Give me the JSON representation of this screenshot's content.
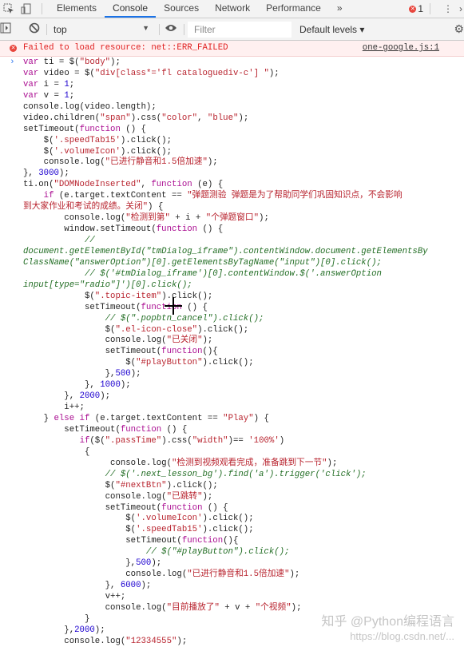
{
  "tabs": {
    "items": [
      "Elements",
      "Console",
      "Sources",
      "Network",
      "Performance"
    ],
    "active": "Console",
    "more": "»",
    "error_count": "1"
  },
  "toolbar": {
    "context": "top",
    "filter_placeholder": "Filter",
    "levels": "Default levels ▾"
  },
  "error": {
    "message": "Failed to load resource: net::ERR_FAILED",
    "source": "one-google.js:1"
  },
  "colors": {
    "keyword": "#aa0d91",
    "string": "#b8232e",
    "number": "#1c00cf",
    "comment": "#236e25",
    "error": "#e02020"
  },
  "watermark": {
    "text": "知乎 @Python编程语言",
    "url": "https://blog.csdn.net/..."
  },
  "code": [
    [
      [
        "k",
        "var"
      ],
      [
        "d",
        " ti = $("
      ],
      [
        "s",
        "\"body\""
      ],
      [
        "d",
        ");"
      ]
    ],
    [
      [
        "k",
        "var"
      ],
      [
        "d",
        " video = $("
      ],
      [
        "s",
        "\"div[class*='fl cataloguediv-c'] \""
      ],
      [
        "d",
        ");"
      ]
    ],
    [
      [
        "k",
        "var"
      ],
      [
        "d",
        " i = "
      ],
      [
        "n",
        "1"
      ],
      [
        "d",
        ";"
      ]
    ],
    [
      [
        "k",
        "var"
      ],
      [
        "d",
        " v = "
      ],
      [
        "n",
        "1"
      ],
      [
        "d",
        ";"
      ]
    ],
    [
      [
        "d",
        "console.log(video.length);"
      ]
    ],
    [
      [
        "d",
        "video.children("
      ],
      [
        "s",
        "\"span\""
      ],
      [
        "d",
        ").css("
      ],
      [
        "s",
        "\"color\""
      ],
      [
        "d",
        ", "
      ],
      [
        "s",
        "\"blue\""
      ],
      [
        "d",
        ");"
      ]
    ],
    [
      [
        "d",
        "setTimeout("
      ],
      [
        "k",
        "function"
      ],
      [
        "d",
        " () {"
      ]
    ],
    [
      [
        "d",
        "    $("
      ],
      [
        "s",
        "'.speedTab15'"
      ],
      [
        "d",
        ").click();"
      ]
    ],
    [
      [
        "d",
        "    $("
      ],
      [
        "s",
        "'.volumeIcon'"
      ],
      [
        "d",
        ").click();"
      ]
    ],
    [
      [
        "d",
        "    console.log("
      ],
      [
        "s",
        "\"已进行静音和1.5倍加速\""
      ],
      [
        "d",
        ");"
      ]
    ],
    [
      [
        "d",
        "}, "
      ],
      [
        "n",
        "3000"
      ],
      [
        "d",
        ");"
      ]
    ],
    [
      [
        "d",
        "ti.on("
      ],
      [
        "s",
        "\"DOMNodeInserted\""
      ],
      [
        "d",
        ", "
      ],
      [
        "k",
        "function"
      ],
      [
        "d",
        " (e) {"
      ]
    ],
    [
      [
        "d",
        "    "
      ],
      [
        "k",
        "if"
      ],
      [
        "d",
        " (e.target.textContent == "
      ],
      [
        "s",
        "\"弹题测验 弹题是为了帮助同学们巩固知识点，不会影响"
      ]
    ],
    [
      [
        "s",
        "到大家作业和考试的成绩。关闭\""
      ],
      [
        "d",
        ") {"
      ]
    ],
    [
      [
        "d",
        "        console.log("
      ],
      [
        "s",
        "\"检测到第\""
      ],
      [
        "d",
        " + i + "
      ],
      [
        "s",
        "\"个弹题窗口\""
      ],
      [
        "d",
        ");"
      ]
    ],
    [
      [
        "d",
        "        window.setTimeout("
      ],
      [
        "k",
        "function"
      ],
      [
        "d",
        " () {"
      ]
    ],
    [
      [
        "c",
        "            //"
      ]
    ],
    [
      [
        "c",
        "document.getElementById(\"tmDialog_iframe\").contentWindow.document.getElementsBy"
      ]
    ],
    [
      [
        "c",
        "ClassName(\"answerOption\")[0].getElementsByTagName(\"input\")[0].click();"
      ]
    ],
    [
      [
        "c",
        "            // $('#tmDialog_iframe')[0].contentWindow.$('.answerOption"
      ]
    ],
    [
      [
        "c",
        "input[type=\"radio\"]')[0].click();"
      ]
    ],
    [
      [
        "d",
        "            $("
      ],
      [
        "s",
        "\".topic-item\""
      ],
      [
        "d",
        ").click();"
      ]
    ],
    [
      [
        "d",
        "            setTimeout("
      ],
      [
        "k",
        "function"
      ],
      [
        "d",
        " () {"
      ]
    ],
    [
      [
        "c",
        "                // $(\".popbtn_cancel\").click();"
      ]
    ],
    [
      [
        "d",
        "                $("
      ],
      [
        "s",
        "\".el-icon-close\""
      ],
      [
        "d",
        ").click();"
      ]
    ],
    [
      [
        "d",
        "                console.log("
      ],
      [
        "s",
        "\"已关闭\""
      ],
      [
        "d",
        ");"
      ]
    ],
    [
      [
        "d",
        "                setTimeout("
      ],
      [
        "k",
        "function"
      ],
      [
        "d",
        "(){"
      ]
    ],
    [
      [
        "d",
        "                    $("
      ],
      [
        "s",
        "\"#playButton\""
      ],
      [
        "d",
        ").click();"
      ]
    ],
    [
      [
        "d",
        "                },"
      ],
      [
        "n",
        "500"
      ],
      [
        "d",
        ");"
      ]
    ],
    [
      [
        "d",
        "            }, "
      ],
      [
        "n",
        "1000"
      ],
      [
        "d",
        ");"
      ]
    ],
    [
      [
        "d",
        "        }, "
      ],
      [
        "n",
        "2000"
      ],
      [
        "d",
        ");"
      ]
    ],
    [
      [
        "d",
        "        i++;"
      ]
    ],
    [
      [
        "d",
        "    } "
      ],
      [
        "k",
        "else if"
      ],
      [
        "d",
        " (e.target.textContent == "
      ],
      [
        "s",
        "\"Play\""
      ],
      [
        "d",
        ") {"
      ]
    ],
    [
      [
        "d",
        "        setTimeout("
      ],
      [
        "k",
        "function"
      ],
      [
        "d",
        " () {"
      ]
    ],
    [
      [
        "d",
        "           "
      ],
      [
        "k",
        "if"
      ],
      [
        "d",
        "($("
      ],
      [
        "s",
        "\".passTime\""
      ],
      [
        "d",
        ").css("
      ],
      [
        "s",
        "\"width\""
      ],
      [
        "d",
        ")== "
      ],
      [
        "s",
        "'100%'"
      ],
      [
        "d",
        ")"
      ]
    ],
    [
      [
        "d",
        "            {"
      ]
    ],
    [
      [
        "d",
        "                 console.log("
      ],
      [
        "s",
        "\"检测到视频观看完成，准备跳到下一节\""
      ],
      [
        "d",
        ");"
      ]
    ],
    [
      [
        "c",
        "                // $('.next_lesson_bg').find('a').trigger('click');"
      ]
    ],
    [
      [
        "d",
        "                $("
      ],
      [
        "s",
        "\"#nextBtn\""
      ],
      [
        "d",
        ").click();"
      ]
    ],
    [
      [
        "d",
        "                console.log("
      ],
      [
        "s",
        "\"已跳转\""
      ],
      [
        "d",
        ");"
      ]
    ],
    [
      [
        "d",
        "                setTimeout("
      ],
      [
        "k",
        "function"
      ],
      [
        "d",
        " () {"
      ]
    ],
    [
      [
        "d",
        "                    $("
      ],
      [
        "s",
        "'.volumeIcon'"
      ],
      [
        "d",
        ").click();"
      ]
    ],
    [
      [
        "d",
        "                    $("
      ],
      [
        "s",
        "'.speedTab15'"
      ],
      [
        "d",
        ").click();"
      ]
    ],
    [
      [
        "d",
        "                    setTimeout("
      ],
      [
        "k",
        "function"
      ],
      [
        "d",
        "(){"
      ]
    ],
    [
      [
        "c",
        "                        // $(\"#playButton\").click();"
      ]
    ],
    [
      [
        "d",
        "                    },"
      ],
      [
        "n",
        "500"
      ],
      [
        "d",
        ");"
      ]
    ],
    [
      [
        "d",
        "                    console.log("
      ],
      [
        "s",
        "\"已进行静音和1.5倍加速\""
      ],
      [
        "d",
        ");"
      ]
    ],
    [
      [
        "d",
        "                }, "
      ],
      [
        "n",
        "6000"
      ],
      [
        "d",
        ");"
      ]
    ],
    [
      [
        "d",
        "                v++;"
      ]
    ],
    [
      [
        "d",
        "                console.log("
      ],
      [
        "s",
        "\"目前播放了\""
      ],
      [
        "d",
        " + v + "
      ],
      [
        "s",
        "\"个视频\""
      ],
      [
        "d",
        ");"
      ]
    ],
    [
      [
        "d",
        "            }"
      ]
    ],
    [
      [
        "d",
        "        },"
      ],
      [
        "n",
        "2000"
      ],
      [
        "d",
        ");"
      ]
    ],
    [
      [
        "d",
        "        console.log("
      ],
      [
        "s",
        "\"12334555\""
      ],
      [
        "d",
        ");"
      ]
    ]
  ]
}
